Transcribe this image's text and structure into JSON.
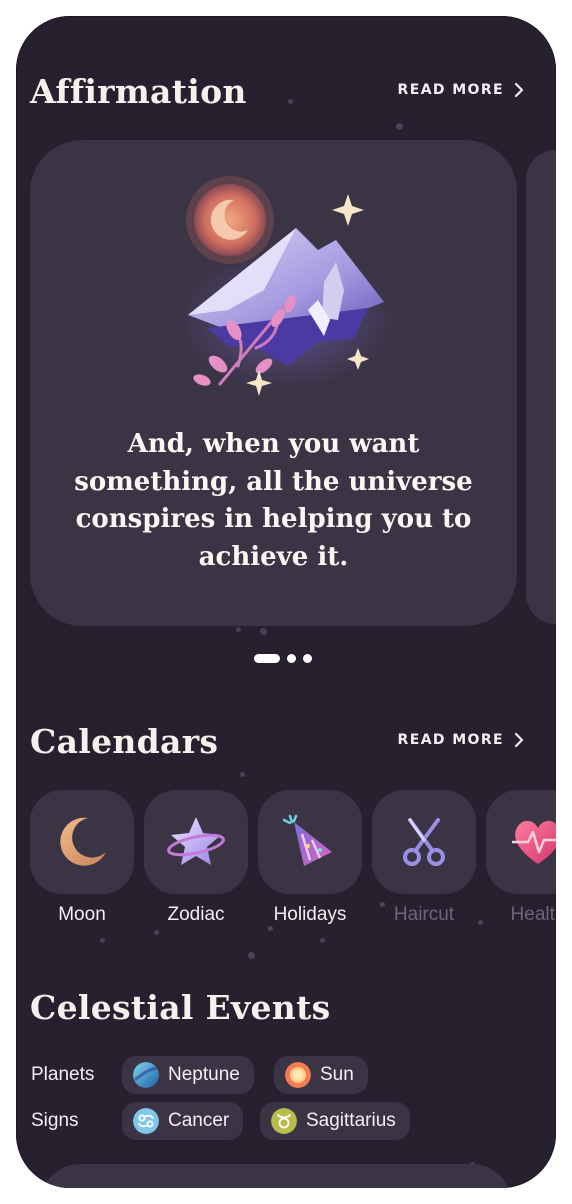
{
  "affirmation": {
    "title": "Affirmation",
    "read_more": "READ MORE",
    "quote": "And, when you want something, all the universe conspires in helping you to achieve it.",
    "pager_count": 3,
    "pager_active": 0
  },
  "calendars": {
    "title": "Calendars",
    "read_more": "READ MORE",
    "items": [
      {
        "label": "Moon",
        "icon": "crescent-moon-icon"
      },
      {
        "label": "Zodiac",
        "icon": "zodiac-star-icon"
      },
      {
        "label": "Holidays",
        "icon": "party-hat-icon"
      },
      {
        "label": "Haircut",
        "icon": "scissors-icon"
      },
      {
        "label": "Health",
        "icon": "heart-pulse-icon"
      }
    ]
  },
  "celestial": {
    "title": "Celestial Events",
    "planets_label": "Planets",
    "signs_label": "Signs",
    "planets": [
      {
        "label": "Neptune",
        "icon": "neptune-icon"
      },
      {
        "label": "Sun",
        "icon": "sun-icon"
      }
    ],
    "signs": [
      {
        "label": "Cancer",
        "icon": "cancer-sign-icon"
      },
      {
        "label": "Sagittarius",
        "icon": "sagittarius-sign-icon"
      }
    ]
  },
  "colors": {
    "background": "#26202f",
    "card": "#3a3445",
    "text": "#f3eef0",
    "dim_text": "#6e6679"
  }
}
